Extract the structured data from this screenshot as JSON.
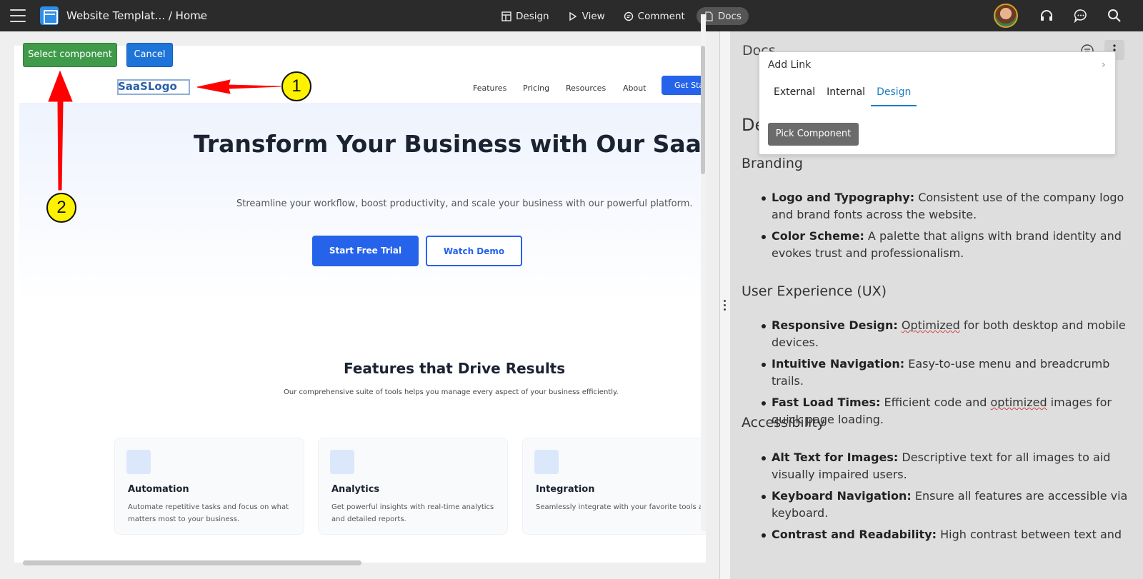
{
  "topbar": {
    "breadcrumb": "Website Templat... / Home",
    "modes": [
      {
        "label": "Design",
        "icon": "layout-icon"
      },
      {
        "label": "View",
        "icon": "play-icon"
      },
      {
        "label": "Comment",
        "icon": "comment-icon"
      },
      {
        "label": "Docs",
        "icon": "doc-icon"
      }
    ],
    "active_mode": "Docs"
  },
  "canvas": {
    "select_button": "Select component",
    "cancel_button": "Cancel",
    "annotations": [
      "1",
      "2"
    ],
    "site": {
      "logo": "SaaSLogo",
      "nav": [
        "Features",
        "Pricing",
        "Resources",
        "About"
      ],
      "cta": "Get Start",
      "hero_title": "Transform Your Business with Our SaaS Solution",
      "hero_subtitle": "Streamline your workflow, boost productivity, and scale your business with our powerful platform.",
      "trial_button": "Start Free Trial",
      "demo_button": "Watch Demo",
      "features_title": "Features that Drive Results",
      "features_subtitle": "Our comprehensive suite of tools helps you manage every aspect of your business efficiently.",
      "cards": [
        {
          "title": "Automation",
          "desc": "Automate repetitive tasks and focus on what matters most to your business."
        },
        {
          "title": "Analytics",
          "desc": "Get powerful insights with real-time analytics and detailed reports."
        },
        {
          "title": "Integration",
          "desc": "Seamlessly integrate with your favorite tools and applications."
        }
      ]
    }
  },
  "docs": {
    "title": "Docs",
    "heading": "De",
    "popup": {
      "title": "Add Link",
      "tabs": [
        "External",
        "Internal",
        "Design"
      ],
      "active_tab": "Design",
      "pick_button": "Pick Component"
    },
    "sections": [
      {
        "heading": "Branding",
        "items": [
          {
            "term": "Logo and Typography:",
            "text": " Consistent use of the company logo and brand fonts across the website."
          },
          {
            "term": "Color Scheme:",
            "text": " A palette that aligns with brand identity and evokes trust and professionalism."
          }
        ]
      },
      {
        "heading": "User Experience (UX)",
        "items": [
          {
            "term": "Responsive Design:",
            "text": " Optimized for both desktop and mobile devices."
          },
          {
            "term": "Intuitive Navigation:",
            "text": " Easy-to-use menu and breadcrumb trails."
          },
          {
            "term": "Fast Load Times:",
            "text": " Efficient code and optimized images for quick page loading."
          }
        ]
      },
      {
        "heading": "Accessibility",
        "items": [
          {
            "term": "Alt Text for Images:",
            "text": " Descriptive text for all images to aid visually impaired users."
          },
          {
            "term": "Keyboard Navigation:",
            "text": " Ensure all features are accessible via keyboard."
          },
          {
            "term": "Contrast and Readability:",
            "text": " High contrast between text and"
          }
        ]
      }
    ]
  },
  "colors": {
    "topbar_bg": "#2b2b2b",
    "select_green": "#3f9b4a",
    "cancel_blue": "#1e74d8",
    "primary_blue": "#2563eb",
    "annotation_yellow": "#fef200",
    "arrow_red": "#ff0000"
  }
}
